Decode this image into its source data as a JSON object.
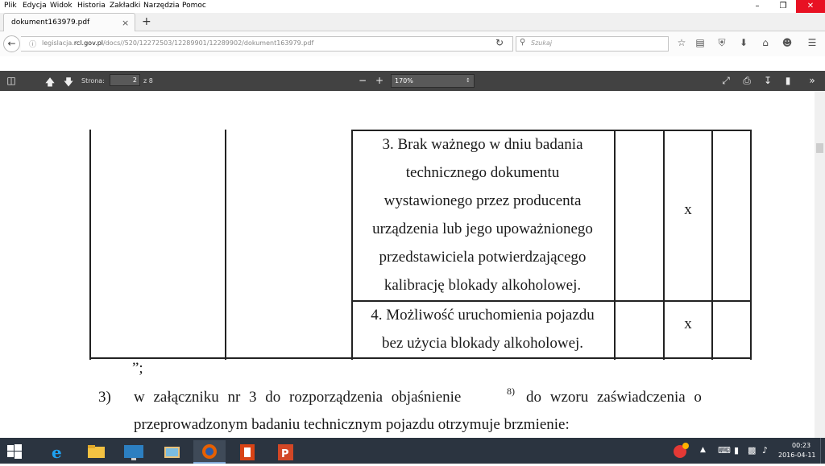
{
  "menu": [
    "Plik",
    "Edycja",
    "Widok",
    "Historia",
    "Zakładki",
    "Narzędzia",
    "Pomoc"
  ],
  "tab": {
    "title": "dokument163979.pdf",
    "close": "×",
    "new": "+"
  },
  "url": {
    "prefix": "legislacja.",
    "domain": "rcl.gov.pl",
    "path": "/docs//520/12272503/12289901/12289902/dokument163979.pdf"
  },
  "search": {
    "placeholder": "Szukaj"
  },
  "pdf_toolbar": {
    "page_label": "Strona:",
    "page_current": "2",
    "page_total": "z 8",
    "zoom": "170%"
  },
  "document": {
    "row3_lines": [
      "3. Brak ważnego w dniu badania",
      "technicznego dokumentu",
      "wystawionego przez producenta",
      "urządzenia lub jego upoważnionego",
      "przedstawiciela potwierdzającego",
      "kalibrację blokady alkoholowej."
    ],
    "row3_mark": "x",
    "row4_lines": [
      "4. Możliwość uruchomienia pojazdu",
      "bez użycia blokady alkoholowej."
    ],
    "row4_mark": "x",
    "closing_quote": "”;",
    "item_number": "3)",
    "item_text": "w załączniku nr 3 do rozporządzenia objaśnienie",
    "footnote": "8)",
    "item_text_end": "do wzoru zaświadczenia o",
    "item_line2": "przeprowadzonym badaniu technicznym pojazdu otrzymuje brzmienie:"
  },
  "taskbar": {
    "time": "00:23",
    "date": "2016-04-11"
  },
  "colors": {
    "pdf_toolbar": "#424242",
    "taskbar": "#2b3440",
    "close_button": "#e81123"
  }
}
